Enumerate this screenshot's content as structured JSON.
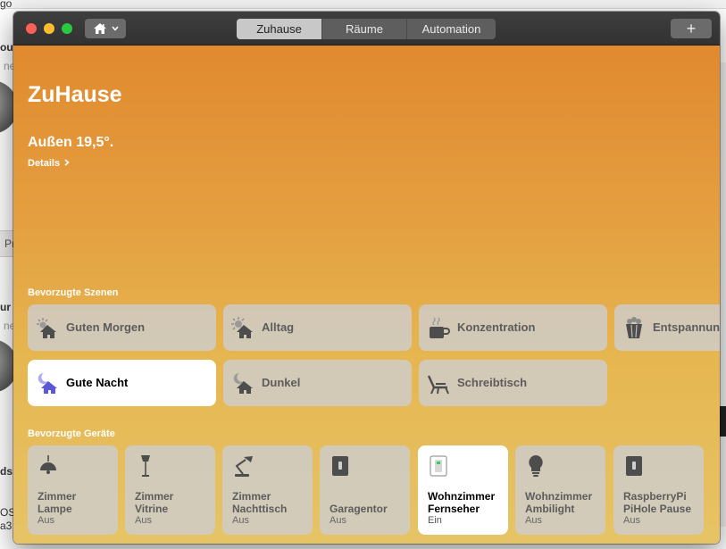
{
  "background": {
    "fragments": [
      "go",
      "ne",
      "ou",
      "Pr",
      "ur",
      "ne",
      "ds",
      "OS",
      "a3"
    ]
  },
  "window": {
    "tabs": [
      {
        "label": "Zuhause",
        "active": true
      },
      {
        "label": "Räume",
        "active": false
      },
      {
        "label": "Automation",
        "active": false
      }
    ],
    "add_label": "+",
    "home_menu_icon": "house-icon"
  },
  "home": {
    "title": "ZuHause",
    "status": "Außen 19,5°.",
    "details_link": "Details"
  },
  "scenes": {
    "title": "Bevorzugte Szenen",
    "items": [
      {
        "label": "Guten Morgen",
        "icon": "sunrise-house-icon",
        "on": false
      },
      {
        "label": "Alltag",
        "icon": "sun-house-icon",
        "on": false
      },
      {
        "label": "Konzentration",
        "icon": "coffee-cup-icon",
        "on": false
      },
      {
        "label": "Entspannung",
        "icon": "popcorn-icon",
        "on": false
      },
      {
        "label": "Gute Nacht",
        "icon": "moon-house-icon",
        "on": true
      },
      {
        "label": "Dunkel",
        "icon": "moon-house-icon",
        "on": false
      },
      {
        "label": "Schreibtisch",
        "icon": "lounge-chair-icon",
        "on": false
      }
    ]
  },
  "devices": {
    "title": "Bevorzugte Geräte",
    "items": [
      {
        "name_line1": "Zimmer",
        "name_line2": "Lampe",
        "state": "Aus",
        "icon": "pendant-lamp-icon",
        "on": false
      },
      {
        "name_line1": "Zimmer",
        "name_line2": "Vitrine",
        "state": "Aus",
        "icon": "floor-lamp-icon",
        "on": false
      },
      {
        "name_line1": "Zimmer",
        "name_line2": "Nachttisch",
        "state": "Aus",
        "icon": "desk-lamp-icon",
        "on": false
      },
      {
        "name_line1": "",
        "name_line2": "Garagentor",
        "state": "Aus",
        "icon": "switch-icon",
        "on": false
      },
      {
        "name_line1": "Wohnzimmer",
        "name_line2": "Fernseher",
        "state": "Ein",
        "icon": "outlet-icon",
        "on": true
      },
      {
        "name_line1": "Wohnzimmer",
        "name_line2": "Ambilight",
        "state": "Aus",
        "icon": "light-bulb-icon",
        "on": false
      },
      {
        "name_line1": "RaspberryPi",
        "name_line2": "PiHole Pause",
        "state": "Aus",
        "icon": "switch-icon",
        "on": false
      }
    ]
  }
}
